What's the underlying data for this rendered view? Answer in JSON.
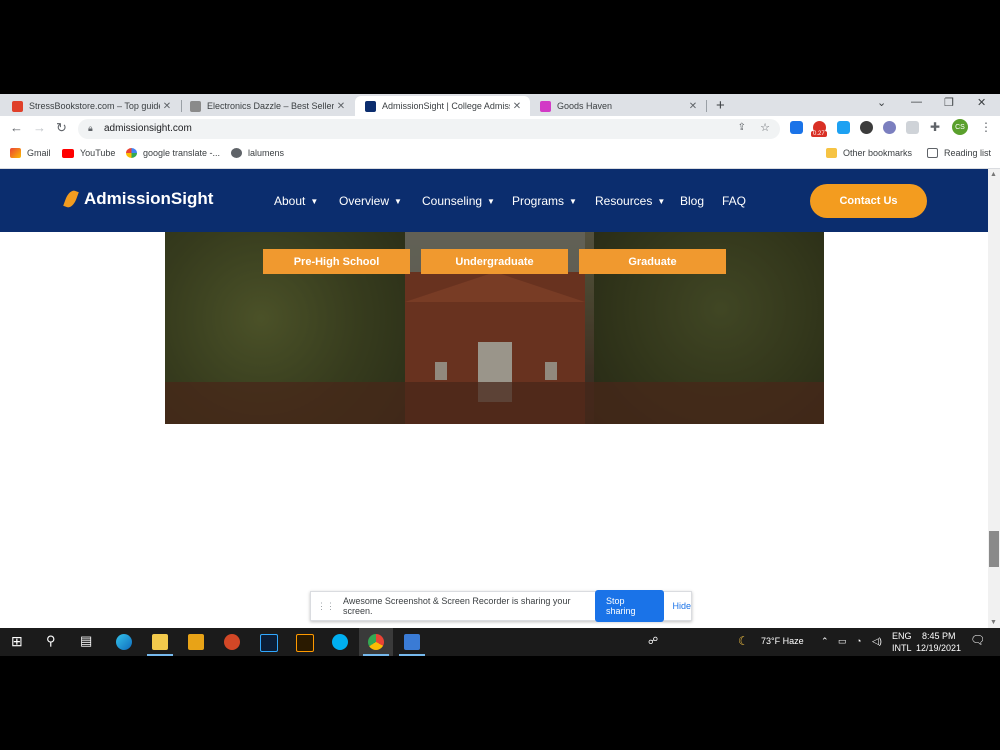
{
  "browser": {
    "tabs": [
      {
        "title": "StressBookstore.com – Top guide",
        "active": false,
        "favicon_color": "#e0402a"
      },
      {
        "title": "Electronics Dazzle – Best Sellers",
        "active": false,
        "favicon_color": "#8a8a8a"
      },
      {
        "title": "AdmissionSight | College Admiss",
        "active": true,
        "favicon_color": "#0b2d6e"
      },
      {
        "title": "Goods Haven",
        "active": false,
        "favicon_color": "#d23ac6"
      }
    ],
    "url": "admissionsight.com",
    "profile_initials": "CS",
    "extension_badge": "0.27",
    "bookmarks": [
      {
        "label": "Gmail",
        "icon": "gmail-icon"
      },
      {
        "label": "YouTube",
        "icon": "youtube-icon"
      },
      {
        "label": "google translate -...",
        "icon": "google-icon"
      },
      {
        "label": "lalumens",
        "icon": "globe-icon"
      }
    ],
    "other_bookmarks": "Other bookmarks",
    "reading_list": "Reading list"
  },
  "site": {
    "logo_text": "AdmissionSight",
    "nav": [
      {
        "label": "About",
        "dropdown": true
      },
      {
        "label": "Overview",
        "dropdown": true
      },
      {
        "label": "Counseling",
        "dropdown": true
      },
      {
        "label": "Programs",
        "dropdown": true
      },
      {
        "label": "Resources",
        "dropdown": true
      },
      {
        "label": "Blog",
        "dropdown": false
      },
      {
        "label": "FAQ",
        "dropdown": false
      }
    ],
    "contact_label": "Contact Us",
    "hero_buttons": [
      "Pre-High School",
      "Undergraduate",
      "Graduate"
    ],
    "colors": {
      "nav_bg": "#0b2d6e",
      "accent": "#f39c1f"
    }
  },
  "share_bar": {
    "message": "Awesome Screenshot & Screen Recorder is sharing your screen.",
    "stop_label": "Stop sharing",
    "hide_label": "Hide"
  },
  "taskbar": {
    "weather": "73°F  Haze",
    "language": [
      "ENG",
      "INTL"
    ],
    "time": "8:45 PM",
    "date": "12/19/2021"
  }
}
